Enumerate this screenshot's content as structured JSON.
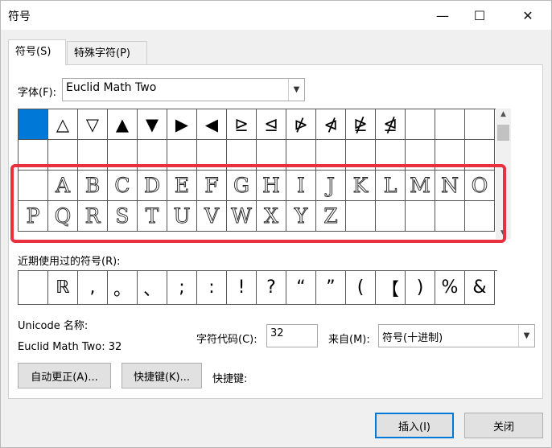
{
  "window": {
    "title": "符号",
    "minimize_glyph": "—",
    "maximize_glyph": "☐",
    "close_glyph": "✕"
  },
  "tabs": [
    {
      "label": "符号(S)",
      "active": true
    },
    {
      "label": "特殊字符(P)",
      "active": false
    }
  ],
  "font": {
    "label": "字体(F):",
    "value": "Euclid Math Two"
  },
  "symbol_grid": {
    "rows": [
      [
        "",
        "△",
        "▽",
        "▲",
        "▼",
        "▶",
        "◀",
        "⊵",
        "⊴",
        "⋫",
        "⋪",
        "⋭",
        "⋬",
        "",
        "",
        ""
      ],
      [
        "",
        "",
        "",
        "",
        "",
        "",
        "",
        "",
        "",
        "",
        "",
        "",
        "",
        "",
        "",
        ""
      ],
      [
        "",
        "A",
        "B",
        "C",
        "D",
        "E",
        "F",
        "G",
        "H",
        "I",
        "J",
        "K",
        "L",
        "M",
        "N",
        "O"
      ],
      [
        "P",
        "Q",
        "R",
        "S",
        "T",
        "U",
        "V",
        "W",
        "X",
        "Y",
        "Z",
        "",
        "",
        "",
        "",
        ""
      ]
    ],
    "selected": {
      "row": 0,
      "col": 0
    }
  },
  "recent": {
    "label": "近期使用过的符号(R):",
    "symbols": [
      "",
      "ℝ",
      ",",
      "。",
      "、",
      ";",
      ":",
      "!",
      "?",
      "“",
      "”",
      "(",
      "【",
      ")",
      "%",
      "&"
    ]
  },
  "unicode": {
    "name_label": "Unicode 名称:",
    "name_value": "Euclid Math Two: 32"
  },
  "char_code": {
    "label": "字符代码(C):",
    "value": "32"
  },
  "from": {
    "label": "来自(M):",
    "value": "符号(十进制)"
  },
  "buttons": {
    "autocorrect": "自动更正(A)...",
    "shortcut_key": "快捷键(K)...",
    "shortcut_label": "快捷键:",
    "insert": "插入(I)",
    "close": "关闭"
  },
  "icons": {
    "dropdown": "chevron-down-icon",
    "scroll_up": "triangle-up-icon",
    "scroll_down": "triangle-down-icon"
  },
  "colors": {
    "selection": "#0078d7",
    "highlight": "#e8303f"
  }
}
